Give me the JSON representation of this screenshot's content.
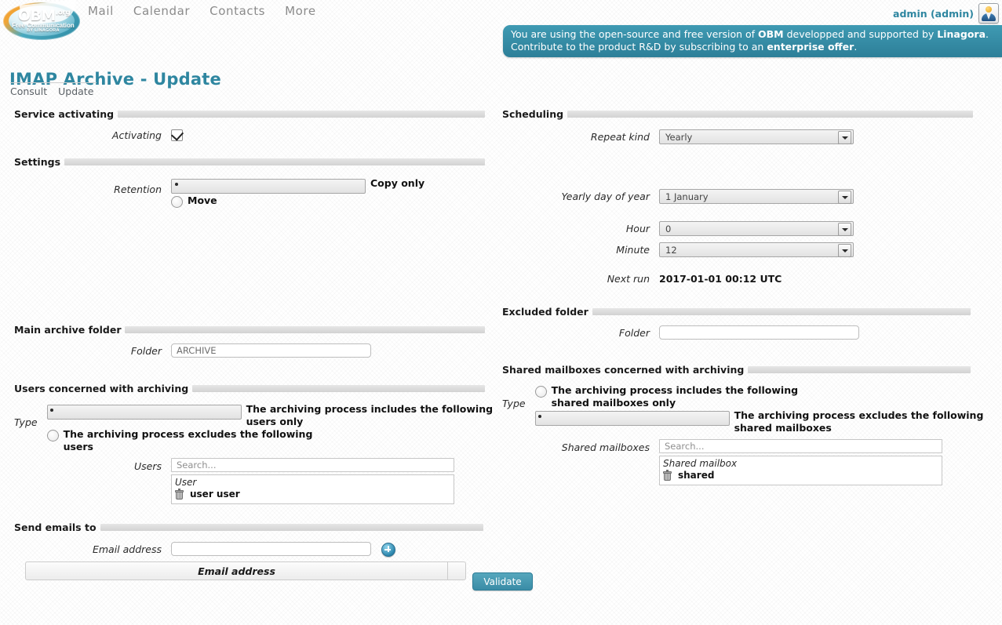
{
  "header": {
    "logo": {
      "name": "OBM",
      "org_suffix": ".org",
      "tagline": "Free Communication",
      "byline": "BY LINAGORA"
    },
    "nav": [
      {
        "label": "Mail"
      },
      {
        "label": "Calendar"
      },
      {
        "label": "Contacts"
      },
      {
        "label": "More"
      }
    ],
    "user": {
      "label": "admin (admin)"
    },
    "banner": {
      "line1_a": "You are using the open-source and free version of ",
      "line1_b": "OBM",
      "line1_c": " developped and supported by ",
      "line1_d": "Linagora",
      "line1_e": ".",
      "line2_a": "Contribute to the product R&D by subscribing to an ",
      "line2_b": "enterprise offer",
      "line2_c": "."
    }
  },
  "page": {
    "title": "IMAP Archive - Update",
    "tabs": [
      {
        "label": "Consult"
      },
      {
        "label": "Update"
      }
    ]
  },
  "service_activating": {
    "heading": "Service activating",
    "activating_label": "Activating",
    "activating_checked": true
  },
  "settings": {
    "heading": "Settings",
    "retention_label": "Retention",
    "options": [
      {
        "label": "Copy only",
        "selected": true
      },
      {
        "label": "Move",
        "selected": false
      }
    ]
  },
  "scheduling": {
    "heading": "Scheduling",
    "repeat_kind_label": "Repeat kind",
    "repeat_kind_value": "Yearly",
    "yearly_day_label": "Yearly day of year",
    "yearly_day_value": "1 January",
    "hour_label": "Hour",
    "hour_value": "0",
    "minute_label": "Minute",
    "minute_value": "12",
    "next_run_label": "Next run",
    "next_run_value": "2017-01-01 00:12 UTC"
  },
  "main_archive_folder": {
    "heading": "Main archive folder",
    "folder_label": "Folder",
    "folder_value": "ARCHIVE"
  },
  "excluded_folder": {
    "heading": "Excluded folder",
    "folder_label": "Folder",
    "folder_value": ""
  },
  "users_concerned": {
    "heading": "Users concerned with archiving",
    "type_label": "Type",
    "options": [
      {
        "label": "The archiving process includes the following users only",
        "selected": true
      },
      {
        "label": "The archiving process excludes the following users",
        "selected": false
      }
    ],
    "users_label": "Users",
    "search_placeholder": "Search...",
    "search_value": "",
    "list_header": "User",
    "items": [
      {
        "name": "user user"
      }
    ]
  },
  "shared_mailboxes_concerned": {
    "heading": "Shared mailboxes concerned with archiving",
    "type_label": "Type",
    "options": [
      {
        "label": "The archiving process includes the following shared mailboxes only",
        "selected": false
      },
      {
        "label": "The archiving process excludes the following shared mailboxes",
        "selected": true
      }
    ],
    "mailboxes_label": "Shared mailboxes",
    "search_placeholder": "Search...",
    "search_value": "",
    "list_header": "Shared mailbox",
    "items": [
      {
        "name": "shared"
      }
    ]
  },
  "send_emails_to": {
    "heading": "Send emails to",
    "email_label": "Email address",
    "email_value": "",
    "add_icon": "plus-circle-icon",
    "table_header": "Email address",
    "rows": []
  },
  "footer": {
    "validate_label": "Validate"
  },
  "colors": {
    "accent": "#2e86a0",
    "banner_bg": "#3f9ab3",
    "button_bg": "#3a8ca6",
    "rule": "#d2d2d2"
  }
}
